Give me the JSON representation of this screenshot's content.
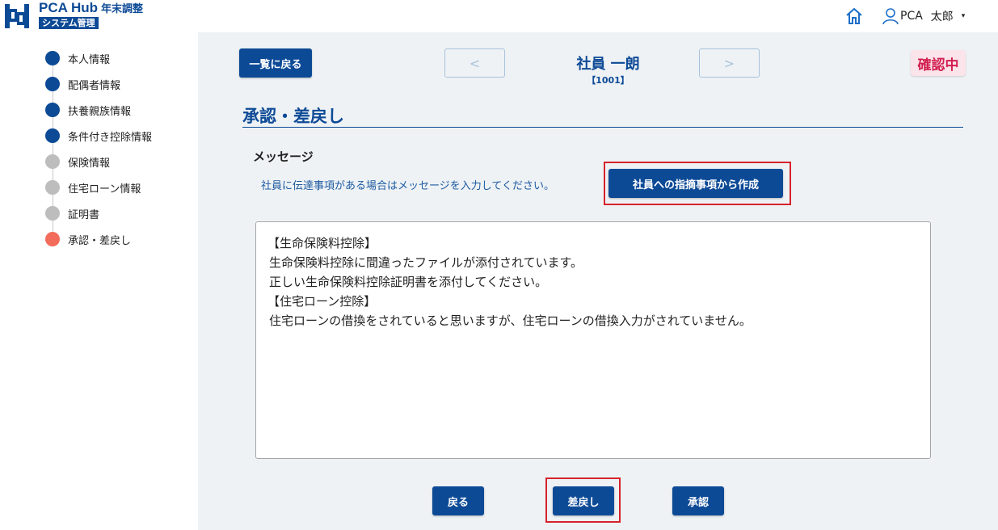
{
  "header": {
    "app_title": "PCA Hub",
    "app_subtitle": "年末調整",
    "app_badge": "システム管理",
    "home_icon": "home-icon",
    "user_icon": "user-icon",
    "user_family": "PCA",
    "user_given": "太郎",
    "user_caret": "▾"
  },
  "sidebar": {
    "steps": [
      {
        "label": "本人情報",
        "status": "done"
      },
      {
        "label": "配偶者情報",
        "status": "done"
      },
      {
        "label": "扶養親族情報",
        "status": "done"
      },
      {
        "label": "条件付き控除情報",
        "status": "done"
      },
      {
        "label": "保険情報",
        "status": "pending"
      },
      {
        "label": "住宅ローン情報",
        "status": "pending"
      },
      {
        "label": "証明書",
        "status": "pending"
      },
      {
        "label": "承認・差戻し",
        "status": "current"
      }
    ]
  },
  "toolbar": {
    "back_to_list_label": "一覧に戻る",
    "prev_label": "<",
    "next_label": ">",
    "employee_name": "社員 一朗",
    "employee_code": "【1001】",
    "status": "確認中"
  },
  "section": {
    "title": "承認・差戻し",
    "message_label": "メッセージ",
    "message_help": "社員に伝達事項がある場合はメッセージを入力してください。",
    "create_from_notes_label": "社員への指摘事項から作成"
  },
  "message": {
    "lines": [
      "【生命保険料控除】",
      "生命保険料控除に間違ったファイルが添付されています。",
      "正しい生命保険料控除証明書を添付してください。",
      "【住宅ローン控除】",
      "住宅ローンの借換をされていると思いますが、住宅ローンの借換入力がされていません。"
    ]
  },
  "actions": {
    "back_label": "戻る",
    "return_label": "差戻し",
    "approve_label": "承認"
  },
  "colors": {
    "brand": "#0d4a96",
    "step_done": "#0d4a96",
    "step_pending": "#bdbdbd",
    "step_current": "#f26b5b",
    "status_text": "#d21f50",
    "highlight": "#d6232b"
  }
}
